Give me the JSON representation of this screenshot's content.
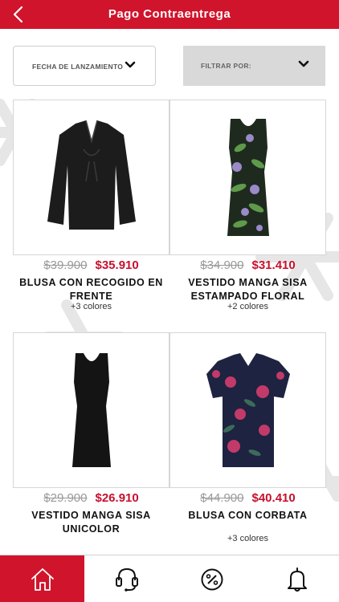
{
  "header": {
    "title": "Pago Contraentrega",
    "back_icon": "chevron-left-icon"
  },
  "filters": {
    "sort_label": "FECHA DE LANZAMIENTO",
    "filter_label": "FILTRAR POR:"
  },
  "products": [
    {
      "old_price": "$39.900",
      "new_price": "$35.910",
      "name": "BLUSA CON RECOGIDO EN FRENTE",
      "colors": "+3 colores"
    },
    {
      "old_price": "$34.900",
      "new_price": "$31.410",
      "name": "VESTIDO MANGA SISA ESTAMPADO FLORAL",
      "colors": "+2 colores"
    },
    {
      "old_price": "$29.900",
      "new_price": "$26.910",
      "name": "VESTIDO MANGA SISA UNICOLOR",
      "colors": ""
    },
    {
      "old_price": "$44.900",
      "new_price": "$40.410",
      "name": "BLUSA CON CORBATA",
      "colors": "+3 colores"
    }
  ],
  "tabbar": {
    "items": [
      "home-icon",
      "headset-icon",
      "discount-icon",
      "bell-icon"
    ],
    "active": "home-icon"
  },
  "colors": {
    "brand": "#d0142c",
    "sale_price": "#c8102e",
    "old_price": "#999999"
  }
}
